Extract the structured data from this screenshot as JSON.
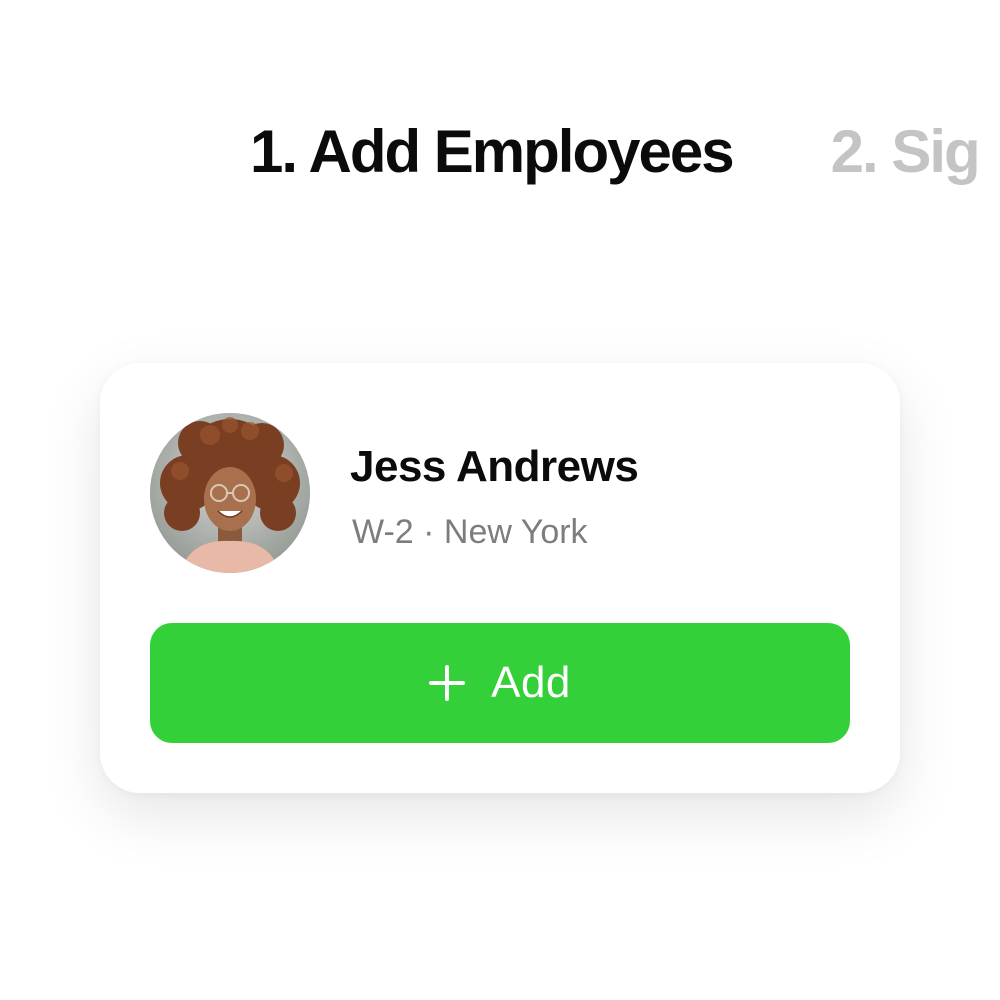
{
  "steps": [
    {
      "label": "1. Add Employees",
      "state": "active"
    },
    {
      "label": "2. Sig",
      "state": "upcoming"
    }
  ],
  "employee": {
    "name": "Jess Andrews",
    "meta": "W-2 · New York",
    "avatar_icon": "profile-photo"
  },
  "actions": {
    "add_label": "Add",
    "add_icon": "plus-icon"
  },
  "colors": {
    "accent": "#34d03a",
    "text_primary": "#0b0b0b",
    "text_secondary": "#7d7d7d",
    "step_inactive": "#c4c4c4"
  }
}
